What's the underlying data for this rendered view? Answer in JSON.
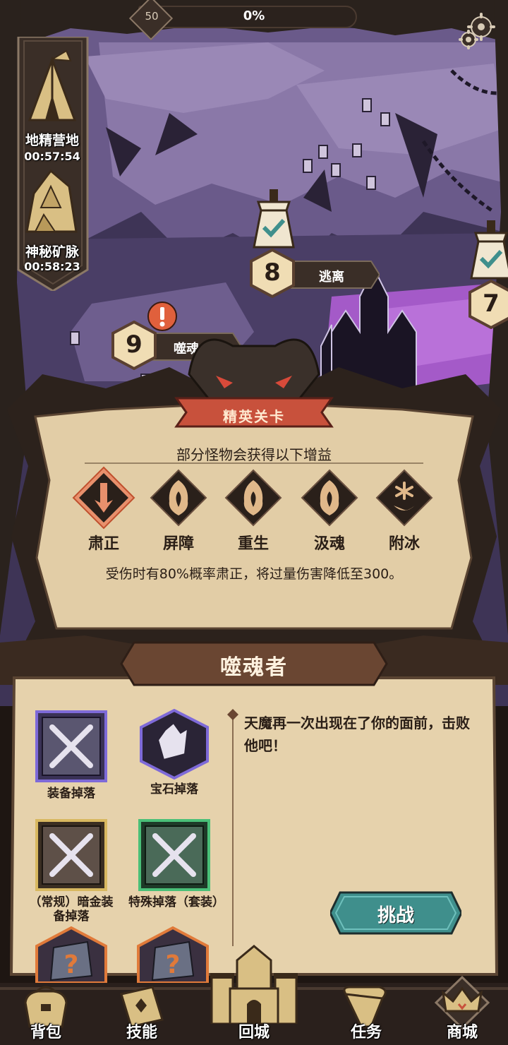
{
  "header": {
    "level": "50",
    "progress": "0%"
  },
  "side_events": [
    {
      "label": "地精营地",
      "time": "00:57:54"
    },
    {
      "label": "神秘矿脉",
      "time": "00:58:23"
    }
  ],
  "stages": [
    {
      "number": "8",
      "label": "逃离"
    },
    {
      "number": "9",
      "label": "噬魂"
    },
    {
      "number": "7",
      "label": ""
    }
  ],
  "elite": {
    "title": "精英关卡",
    "subtitle": "部分怪物会获得以下增益",
    "buffs": [
      {
        "label": "肃正",
        "icon": "sword-down-icon",
        "selected": true
      },
      {
        "label": "屏障",
        "icon": "flame-shield-icon",
        "selected": false
      },
      {
        "label": "重生",
        "icon": "flame-shield-icon",
        "selected": false
      },
      {
        "label": "汲魂",
        "icon": "flame-shield-icon",
        "selected": false
      },
      {
        "label": "附冰",
        "icon": "snowflake-icon",
        "selected": false
      }
    ],
    "description": "受伤时有80%概率肃正，将过量伤害降低至300。"
  },
  "boss": {
    "name": "噬魂者",
    "description": "天魔再一次出现在了你的面前，击败他吧！",
    "drops": [
      {
        "label": "装备掉落"
      },
      {
        "label": "宝石掉落"
      },
      {
        "label": "（常规）暗金装备掉落"
      },
      {
        "label": "特殊掉落（套装）"
      }
    ],
    "challenge_label": "挑战"
  },
  "nav": {
    "bag": "背包",
    "skills": "技能",
    "town": "回城",
    "tasks": "任务",
    "shop": "商城"
  },
  "colors": {
    "map_purple": "#5a4a7a",
    "parchment": "#e8d4b0",
    "elite_banner": "#c8513c",
    "challenge_teal": "#3f8f8c"
  }
}
